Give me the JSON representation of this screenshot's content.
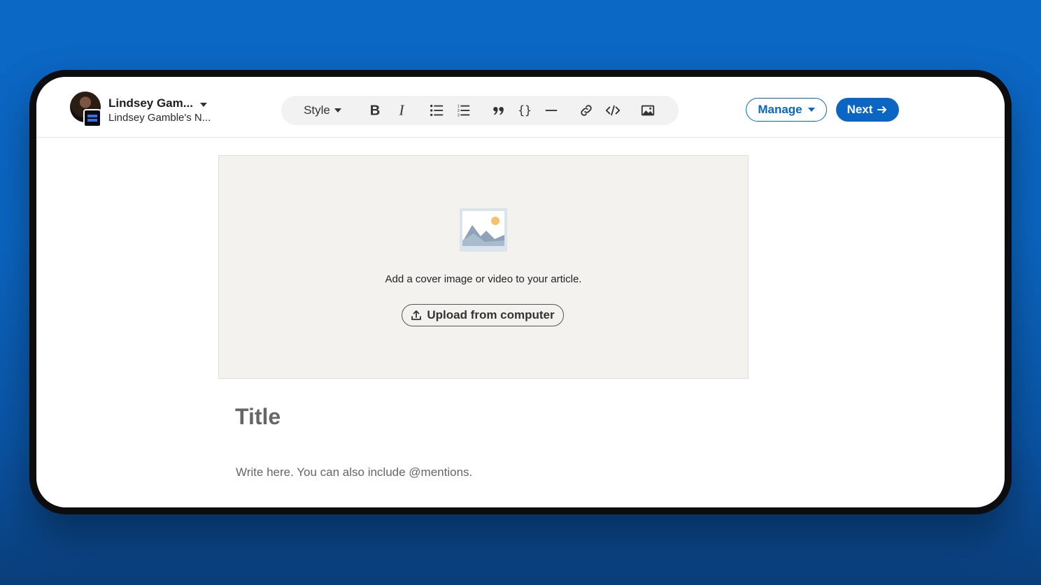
{
  "author": {
    "name": "Lindsey Gam...",
    "subtitle": "Lindsey Gamble's N..."
  },
  "toolbar": {
    "style_label": "Style",
    "icons": [
      "bold-icon",
      "italic-icon",
      "bulleted-list-icon",
      "numbered-list-icon",
      "quote-icon",
      "code-block-icon",
      "divider-icon",
      "link-icon",
      "embed-code-icon",
      "image-icon"
    ]
  },
  "actions": {
    "manage_label": "Manage",
    "next_label": "Next"
  },
  "cover": {
    "prompt": "Add a cover image or video to your article.",
    "upload_label": "Upload from computer"
  },
  "editor": {
    "title_placeholder": "Title",
    "body_placeholder": "Write here. You can also include @mentions."
  },
  "colors": {
    "accent": "#0a66c2",
    "background": "#0b66c2",
    "cover_bg": "#f3f2ef"
  }
}
